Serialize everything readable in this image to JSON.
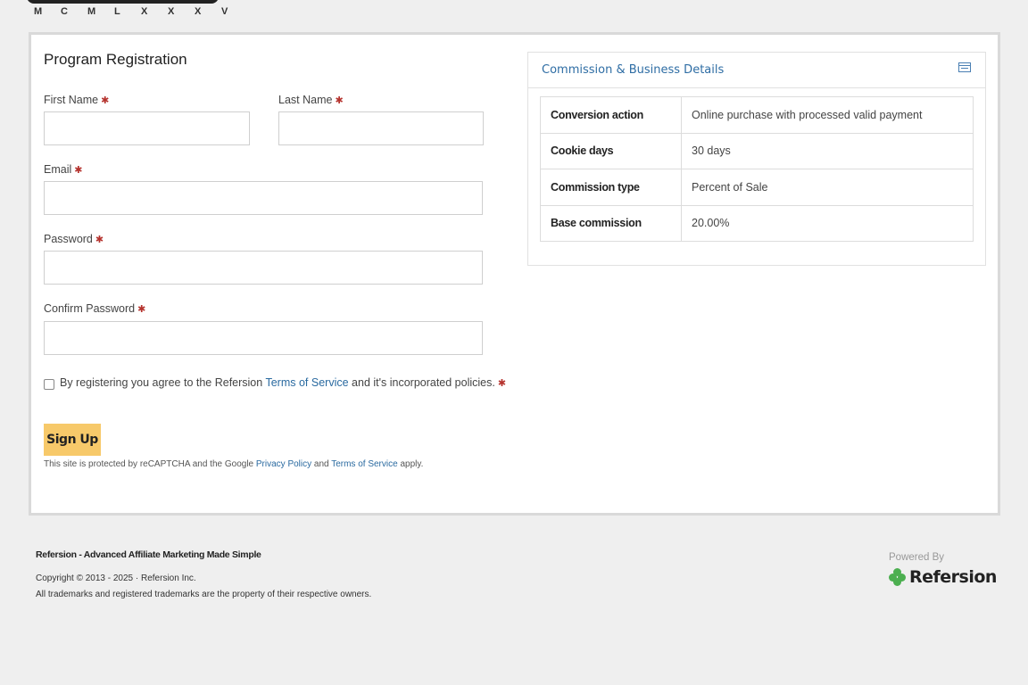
{
  "logo": {
    "letters": [
      "M",
      "C",
      "M",
      "L",
      "X",
      "X",
      "X",
      "V"
    ]
  },
  "form": {
    "title": "Program Registration",
    "first_name_label": "First Name",
    "last_name_label": "Last Name",
    "email_label": "Email",
    "password_label": "Password",
    "confirm_password_label": "Confirm Password",
    "required_mark": "✱",
    "agree_text_1": "By registering you agree to the Refersion ",
    "agree_link": "Terms of Service",
    "agree_text_2": " and it's incorporated policies.",
    "signup_label": "Sign Up",
    "recaptcha_1": "This site is protected by reCAPTCHA and the Google ",
    "recaptcha_privacy": "Privacy Policy",
    "recaptcha_and": " and ",
    "recaptcha_terms": "Terms of Service",
    "recaptcha_2": " apply."
  },
  "details": {
    "title": "Commission & Business Details",
    "rows": [
      {
        "key": "Conversion action",
        "value": "Online purchase with processed valid payment"
      },
      {
        "key": "Cookie days",
        "value": "30 days"
      },
      {
        "key": "Commission type",
        "value": "Percent of Sale"
      },
      {
        "key": "Base commission",
        "value": "20.00%"
      }
    ]
  },
  "footer": {
    "title": "Refersion - Advanced Affiliate Marketing Made Simple",
    "copyright": "Copyright © 2013 - 2025 · Refersion Inc.",
    "trademarks": "All trademarks and registered trademarks are the property of their respective owners.",
    "powered_by": "Powered By",
    "brand": "Refersion"
  },
  "colors": {
    "accent_button": "#f7c96a",
    "link": "#2a6aa0",
    "required": "#b5332e",
    "brand_green": "#4caf50"
  }
}
